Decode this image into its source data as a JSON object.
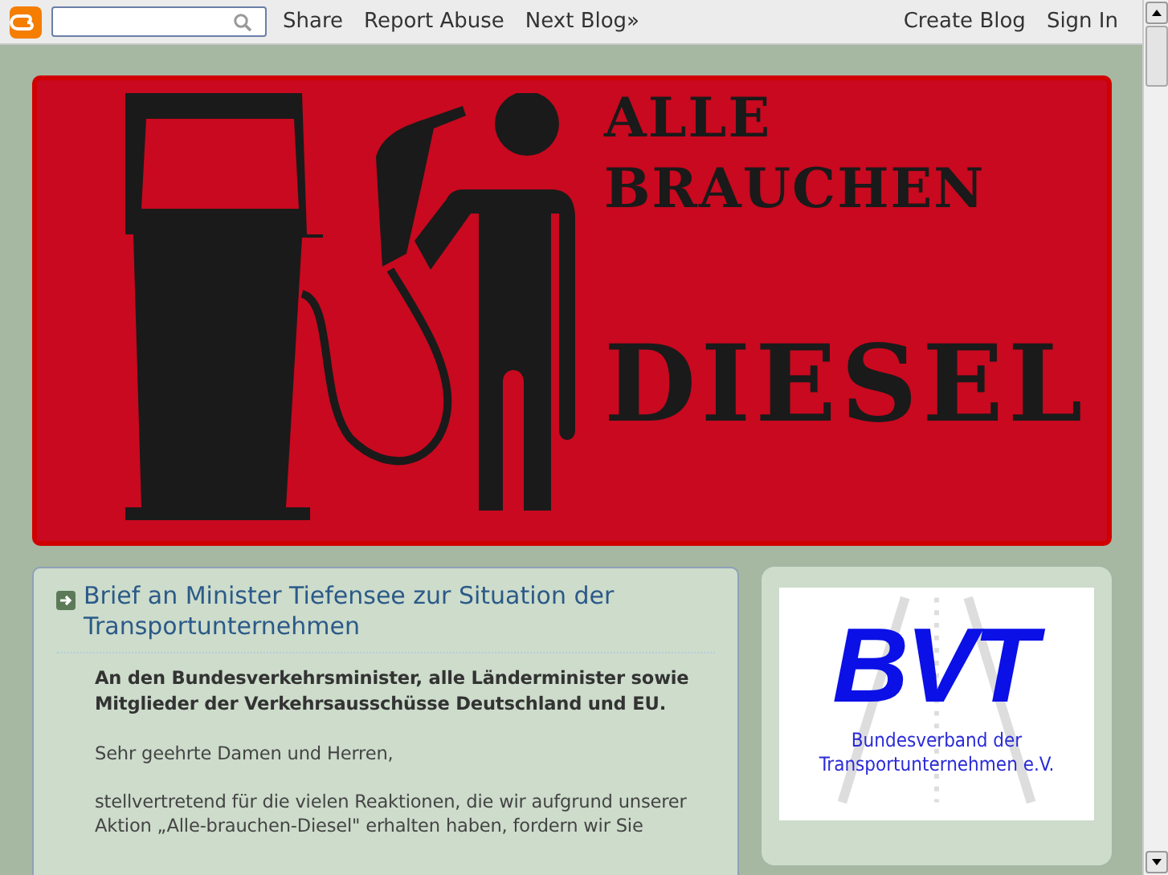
{
  "navbar": {
    "links_left": [
      "Share",
      "Report Abuse",
      "Next Blog»"
    ],
    "links_right": [
      "Create Blog",
      "Sign In"
    ]
  },
  "header": {
    "line_1": "ALLE",
    "line_2": "BRAUCHEN",
    "line_3": "DIESEL"
  },
  "post": {
    "title": "Brief an Minister Tiefensee zur Situation der Transportunternehmen",
    "intro": "An den Bundesverkehrsminister, alle Länderminister sowie Mitglieder der Verkehrsausschüsse Deutschland und EU.",
    "paragraphs": [
      "Sehr geehrte Damen und Herren,",
      "stellvertretend für die vielen Reaktionen, die wir aufgrund unserer Aktion „Alle-brauchen-Diesel\" erhalten haben, fordern wir Sie"
    ]
  },
  "sidebar": {
    "logo": {
      "letters": "BVT",
      "line_1": "Bundesverband der",
      "line_2": "Transportunternehmen e.V."
    }
  }
}
